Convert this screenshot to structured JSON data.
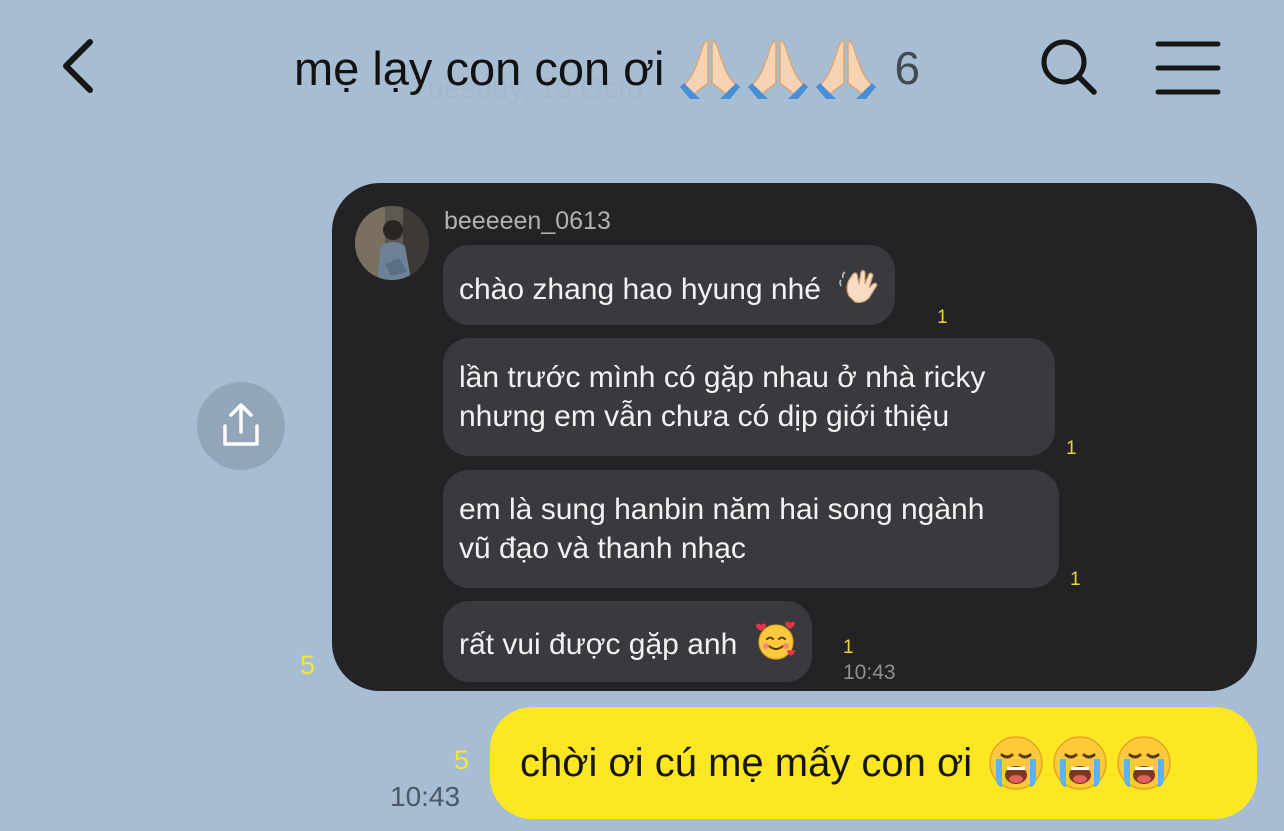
{
  "header": {
    "title": "mẹ lạy con con ơi",
    "title_emojis": [
      "pray-emoji",
      "pray-emoji",
      "pray-emoji"
    ],
    "member_count": "6",
    "faint_date": "Tuesday, 10 Octo",
    "icons": {
      "back": "chevron-left-icon",
      "search": "search-icon",
      "menu": "hamburger-menu-icon"
    }
  },
  "share_button": {
    "icon": "share-upload-icon"
  },
  "image_message": {
    "unread": "5",
    "screenshot": {
      "username": "beeeeen_0613",
      "messages": [
        {
          "text": "chào zhang hao hyung nhé",
          "emoji": "waving-hand-emoji",
          "unread": "1"
        },
        {
          "lines": [
            "lần trước mình có gặp nhau ở nhà ricky",
            "nhưng em vẫn chưa có dịp giới thiệu"
          ],
          "unread": "1"
        },
        {
          "lines": [
            "em là sung hanbin năm hai song ngành",
            "vũ đạo và thanh nhạc"
          ],
          "unread": "1"
        },
        {
          "text": "rất vui được gặp anh",
          "emoji": "smiling-face-with-hearts-emoji",
          "unread": "1",
          "time": "10:43"
        }
      ]
    }
  },
  "my_message": {
    "text": "chời ơi cú mẹ mấy con ơi",
    "emojis": [
      "loudly-crying-face-emoji",
      "loudly-crying-face-emoji",
      "loudly-crying-face-emoji"
    ],
    "unread": "5",
    "time": "10:43"
  },
  "colors": {
    "background": "#a6bdd3",
    "my_bubble": "#fde722",
    "screenshot_bg": "#232326",
    "dm_bubble": "#3a3a3e",
    "unread_yellow": "#f7e633"
  }
}
